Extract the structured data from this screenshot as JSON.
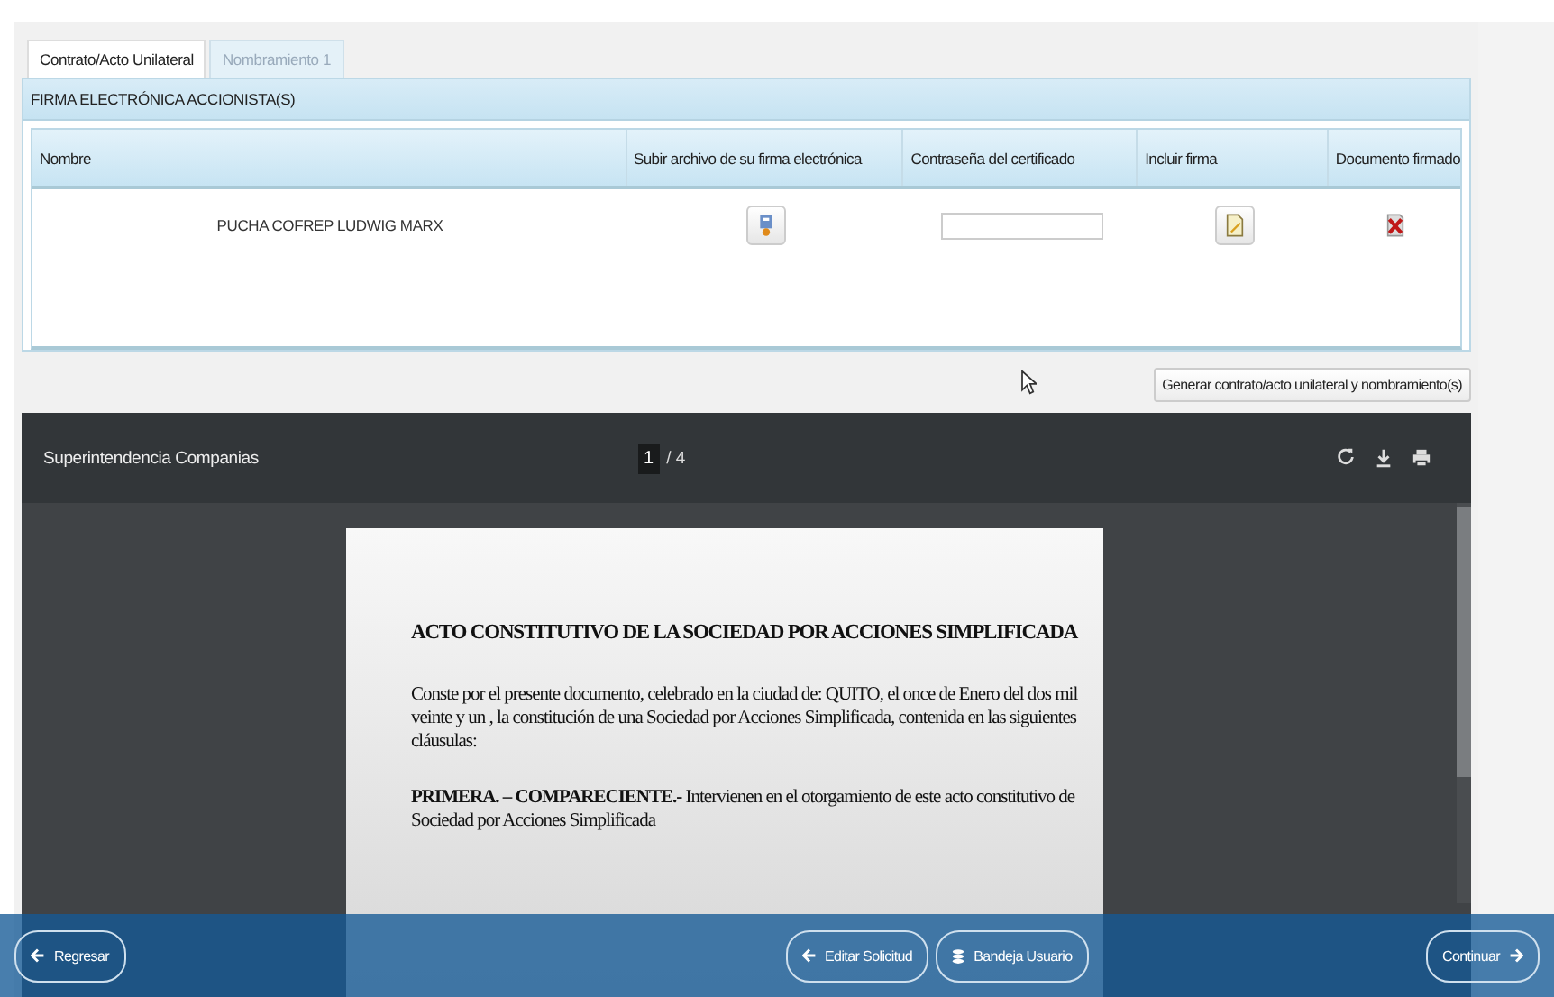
{
  "tabs": [
    {
      "label": "Contrato/Acto Unilateral",
      "selected": true
    },
    {
      "label": "Nombramiento 1",
      "selected": false
    }
  ],
  "panel": {
    "title": "FIRMA ELECTRÓNICA ACCIONISTA(S)"
  },
  "table": {
    "columns": [
      "Nombre",
      "Subir archivo de su firma electrónica",
      "Contraseña del certificado",
      "Incluir firma",
      "Documento firmado"
    ],
    "rows": [
      {
        "name": "PUCHA COFREP LUDWIG MARX"
      }
    ]
  },
  "generate_button": "Generar contrato/acto unilateral y nombramiento(s)",
  "viewer": {
    "title": "Superintendencia Companias",
    "page": "1",
    "total": "/ 4",
    "document": {
      "heading": "ACTO CONSTITUTIVO DE LA SOCIEDAD POR ACCIONES SIMPLIFICADA",
      "paragraphs": [
        "Conste por el presente documento, celebrado en la ciudad de: QUITO, el once  de Enero del dos mil veinte y un , la constitución de una Sociedad por Acciones Simplificada, contenida en las siguientes cláusulas:",
        "**PRIMERA. – COMPARECIENTE.-** Intervienen en el otorgamiento de este acto constitutivo de Sociedad por Acciones Simplificada"
      ]
    }
  },
  "footer": {
    "back": "Regresar",
    "edit": "Editar Solicitud",
    "inbox": "Bandeja Usuario",
    "next": "Continuar"
  }
}
